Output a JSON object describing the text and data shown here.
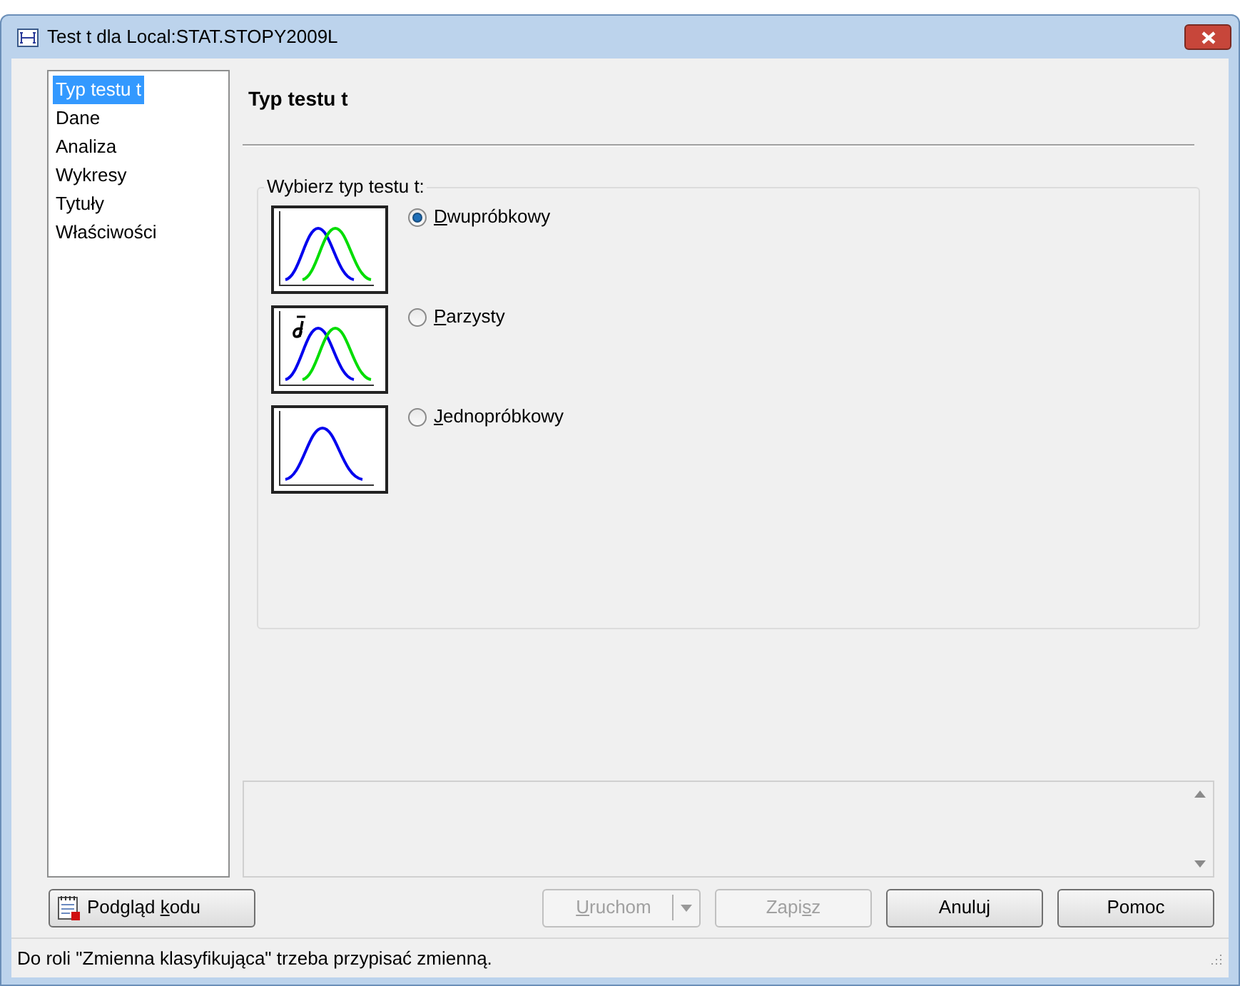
{
  "window": {
    "title": "Test t dla Local:STAT.STOPY2009L"
  },
  "sidebar": {
    "items": [
      {
        "label": "Typ testu t",
        "selected": true
      },
      {
        "label": "Dane",
        "selected": false
      },
      {
        "label": "Analiza",
        "selected": false
      },
      {
        "label": "Wykresy",
        "selected": false
      },
      {
        "label": "Tytuły",
        "selected": false
      },
      {
        "label": "Właściwości",
        "selected": false
      }
    ]
  },
  "panel": {
    "heading": "Typ testu t",
    "group_label": "Wybierz typ testu t:",
    "options": [
      {
        "kind": "two",
        "accel": "D",
        "after": "wupróbkowy",
        "selected": true
      },
      {
        "kind": "paired",
        "accel": "P",
        "after": "arzysty",
        "selected": false
      },
      {
        "kind": "one",
        "accel": "J",
        "after": "ednopróbkowy",
        "selected": false
      }
    ]
  },
  "buttons": [
    {
      "kind": "code",
      "before": "Podgląd ",
      "accel": "k",
      "after": "odu",
      "disabled": false
    },
    {
      "kind": "split",
      "accel": "U",
      "after": "ruchom",
      "disabled": true
    },
    {
      "kind": "plain",
      "before": "Zapi",
      "accel": "s",
      "after": "z",
      "disabled": true
    },
    {
      "kind": "plain",
      "before": "Anuluj",
      "disabled": false
    },
    {
      "kind": "plain",
      "before": "Pomoc",
      "disabled": false
    }
  ],
  "status_bar": "Do roli \"Zmienna klasyfikująca\" trzeba przypisać zmienną."
}
